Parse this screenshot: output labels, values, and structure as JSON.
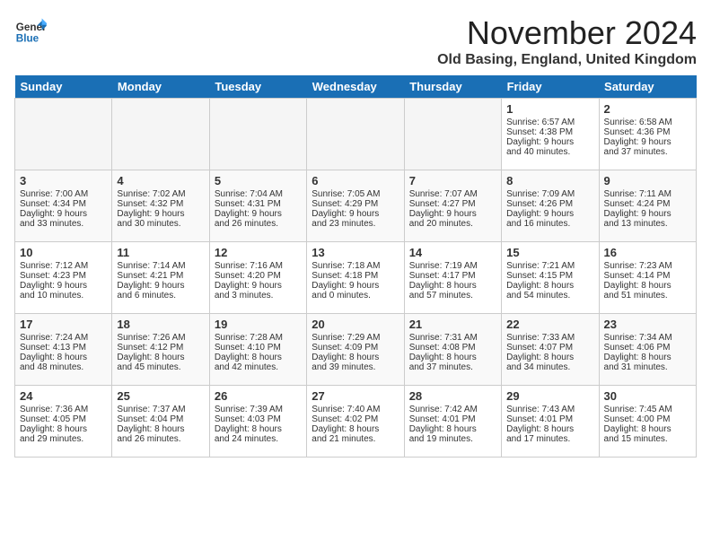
{
  "header": {
    "logo_line1": "General",
    "logo_line2": "Blue",
    "month": "November 2024",
    "location": "Old Basing, England, United Kingdom"
  },
  "days_of_week": [
    "Sunday",
    "Monday",
    "Tuesday",
    "Wednesday",
    "Thursday",
    "Friday",
    "Saturday"
  ],
  "weeks": [
    [
      {
        "day": "",
        "info": ""
      },
      {
        "day": "",
        "info": ""
      },
      {
        "day": "",
        "info": ""
      },
      {
        "day": "",
        "info": ""
      },
      {
        "day": "",
        "info": ""
      },
      {
        "day": "1",
        "info": "Sunrise: 6:57 AM\nSunset: 4:38 PM\nDaylight: 9 hours\nand 40 minutes."
      },
      {
        "day": "2",
        "info": "Sunrise: 6:58 AM\nSunset: 4:36 PM\nDaylight: 9 hours\nand 37 minutes."
      }
    ],
    [
      {
        "day": "3",
        "info": "Sunrise: 7:00 AM\nSunset: 4:34 PM\nDaylight: 9 hours\nand 33 minutes."
      },
      {
        "day": "4",
        "info": "Sunrise: 7:02 AM\nSunset: 4:32 PM\nDaylight: 9 hours\nand 30 minutes."
      },
      {
        "day": "5",
        "info": "Sunrise: 7:04 AM\nSunset: 4:31 PM\nDaylight: 9 hours\nand 26 minutes."
      },
      {
        "day": "6",
        "info": "Sunrise: 7:05 AM\nSunset: 4:29 PM\nDaylight: 9 hours\nand 23 minutes."
      },
      {
        "day": "7",
        "info": "Sunrise: 7:07 AM\nSunset: 4:27 PM\nDaylight: 9 hours\nand 20 minutes."
      },
      {
        "day": "8",
        "info": "Sunrise: 7:09 AM\nSunset: 4:26 PM\nDaylight: 9 hours\nand 16 minutes."
      },
      {
        "day": "9",
        "info": "Sunrise: 7:11 AM\nSunset: 4:24 PM\nDaylight: 9 hours\nand 13 minutes."
      }
    ],
    [
      {
        "day": "10",
        "info": "Sunrise: 7:12 AM\nSunset: 4:23 PM\nDaylight: 9 hours\nand 10 minutes."
      },
      {
        "day": "11",
        "info": "Sunrise: 7:14 AM\nSunset: 4:21 PM\nDaylight: 9 hours\nand 6 minutes."
      },
      {
        "day": "12",
        "info": "Sunrise: 7:16 AM\nSunset: 4:20 PM\nDaylight: 9 hours\nand 3 minutes."
      },
      {
        "day": "13",
        "info": "Sunrise: 7:18 AM\nSunset: 4:18 PM\nDaylight: 9 hours\nand 0 minutes."
      },
      {
        "day": "14",
        "info": "Sunrise: 7:19 AM\nSunset: 4:17 PM\nDaylight: 8 hours\nand 57 minutes."
      },
      {
        "day": "15",
        "info": "Sunrise: 7:21 AM\nSunset: 4:15 PM\nDaylight: 8 hours\nand 54 minutes."
      },
      {
        "day": "16",
        "info": "Sunrise: 7:23 AM\nSunset: 4:14 PM\nDaylight: 8 hours\nand 51 minutes."
      }
    ],
    [
      {
        "day": "17",
        "info": "Sunrise: 7:24 AM\nSunset: 4:13 PM\nDaylight: 8 hours\nand 48 minutes."
      },
      {
        "day": "18",
        "info": "Sunrise: 7:26 AM\nSunset: 4:12 PM\nDaylight: 8 hours\nand 45 minutes."
      },
      {
        "day": "19",
        "info": "Sunrise: 7:28 AM\nSunset: 4:10 PM\nDaylight: 8 hours\nand 42 minutes."
      },
      {
        "day": "20",
        "info": "Sunrise: 7:29 AM\nSunset: 4:09 PM\nDaylight: 8 hours\nand 39 minutes."
      },
      {
        "day": "21",
        "info": "Sunrise: 7:31 AM\nSunset: 4:08 PM\nDaylight: 8 hours\nand 37 minutes."
      },
      {
        "day": "22",
        "info": "Sunrise: 7:33 AM\nSunset: 4:07 PM\nDaylight: 8 hours\nand 34 minutes."
      },
      {
        "day": "23",
        "info": "Sunrise: 7:34 AM\nSunset: 4:06 PM\nDaylight: 8 hours\nand 31 minutes."
      }
    ],
    [
      {
        "day": "24",
        "info": "Sunrise: 7:36 AM\nSunset: 4:05 PM\nDaylight: 8 hours\nand 29 minutes."
      },
      {
        "day": "25",
        "info": "Sunrise: 7:37 AM\nSunset: 4:04 PM\nDaylight: 8 hours\nand 26 minutes."
      },
      {
        "day": "26",
        "info": "Sunrise: 7:39 AM\nSunset: 4:03 PM\nDaylight: 8 hours\nand 24 minutes."
      },
      {
        "day": "27",
        "info": "Sunrise: 7:40 AM\nSunset: 4:02 PM\nDaylight: 8 hours\nand 21 minutes."
      },
      {
        "day": "28",
        "info": "Sunrise: 7:42 AM\nSunset: 4:01 PM\nDaylight: 8 hours\nand 19 minutes."
      },
      {
        "day": "29",
        "info": "Sunrise: 7:43 AM\nSunset: 4:01 PM\nDaylight: 8 hours\nand 17 minutes."
      },
      {
        "day": "30",
        "info": "Sunrise: 7:45 AM\nSunset: 4:00 PM\nDaylight: 8 hours\nand 15 minutes."
      }
    ]
  ]
}
